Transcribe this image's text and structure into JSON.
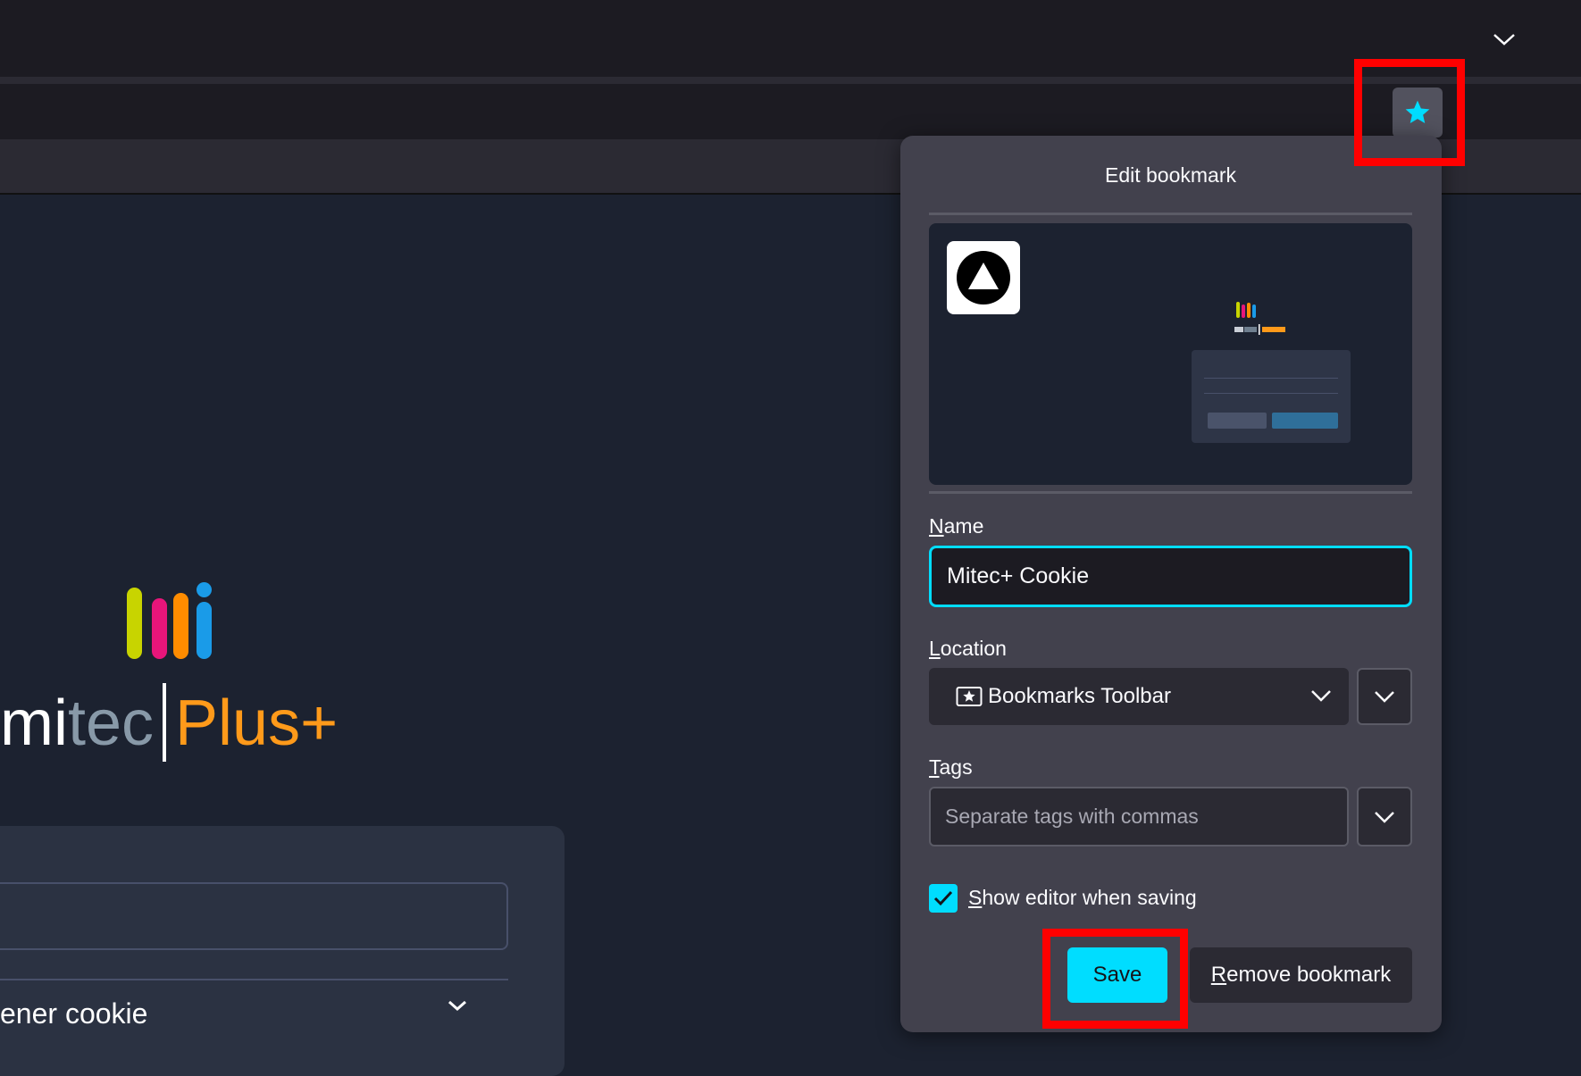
{
  "browser": {
    "tabs_menu_icon": "chevron-down-icon",
    "bookmark_star_icon": "star-icon"
  },
  "page": {
    "logo": {
      "brand_mi": "mi",
      "brand_tec": "tec",
      "brand_plus": "Plus+",
      "bar_colors": [
        "#c8d400",
        "#e8157a",
        "#ff8c00",
        "#1a9be8"
      ]
    },
    "cookie_select_text": "ener cookie"
  },
  "panel": {
    "title": "Edit bookmark",
    "name_label_accesskey": "N",
    "name_label_rest": "ame",
    "name_value": "Mitec+ Cookie",
    "location_label_accesskey": "L",
    "location_label_rest": "ocation",
    "location_value": "Bookmarks Toolbar",
    "tags_label_accesskey": "T",
    "tags_label_rest": "ags",
    "tags_placeholder": "Separate tags with commas",
    "show_editor_checked": true,
    "show_editor_accesskey": "S",
    "show_editor_rest": "how editor when saving",
    "save_label": "Save",
    "remove_accesskey": "R",
    "remove_rest": "emove bookmark"
  },
  "colors": {
    "accent": "#00ddff",
    "highlight": "#ff0000",
    "panel_bg": "#42414d"
  }
}
